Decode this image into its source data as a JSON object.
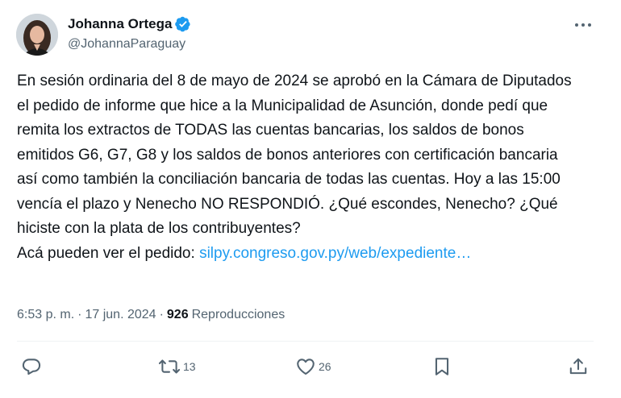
{
  "author": {
    "name": "Johanna Ortega",
    "handle": "@JohannaParaguay",
    "verified_color": "#1d9bf0"
  },
  "tweet": {
    "text": "En sesión ordinaria del 8 de mayo de 2024 se aprobó en la Cámara de Diputados el pedido de informe que hice a la Municipalidad de Asunción, donde pedí que remita los extractos de TODAS las cuentas bancarias, los saldos de bonos emitidos G6, G7, G8 y los saldos de bonos anteriores con certificación bancaria así como también la conciliación bancaria de todas las cuentas. Hoy a las 15:00 vencía el plazo y Nenecho NO RESPONDIÓ. ¿Qué escondes, Nenecho? ¿Qué hiciste con la plata de los contribuyentes?\nAcá pueden ver el pedido: ",
    "link_text": "silpy.congreso.gov.py/web/expediente…"
  },
  "meta": {
    "time": "6:53 p. m.",
    "separator": "·",
    "date": "17 jun. 2024",
    "views_count": "926",
    "views_label": "Reproducciones"
  },
  "actions": {
    "reply_count": "",
    "retweet_count": "13",
    "like_count": "26",
    "bookmark_count": "",
    "share_count": ""
  },
  "icons": {
    "more": "more-icon",
    "reply": "reply-icon",
    "retweet": "retweet-icon",
    "like": "heart-icon",
    "bookmark": "bookmark-icon",
    "share": "share-icon",
    "verified": "verified-badge-icon"
  },
  "colors": {
    "text": "#0f1419",
    "secondary": "#536471",
    "link": "#1d9bf0",
    "divider": "#eff3f4"
  }
}
